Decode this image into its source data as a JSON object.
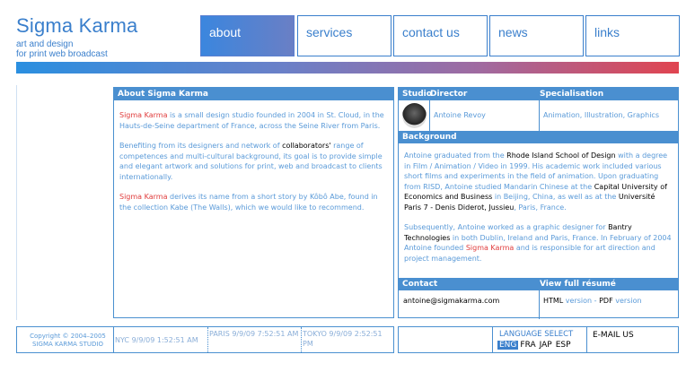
{
  "logo": {
    "title": "Sigma Karma",
    "subtitle_line1": "art and design",
    "subtitle_line2": "for print web broadcast"
  },
  "nav": [
    {
      "label": "about",
      "active": true
    },
    {
      "label": "services",
      "active": false
    },
    {
      "label": "contact us",
      "active": false
    },
    {
      "label": "news",
      "active": false
    },
    {
      "label": "links",
      "active": false
    }
  ],
  "about": {
    "header": "About Sigma Karma",
    "p1_brand": "Sigma Karma",
    "p1_rest": " is a small design studio founded in 2004 in St. Cloud, in the Hauts-de-Seine department of France, across the Seine River from Paris.",
    "p2_start": "Benefiting from its designers and network of ",
    "p2_link": "collaborators'",
    "p2_rest": " range of competences and multi-cultural background, its goal is to provide simple and elegant artwork and solutions for print, web and broadcast to clients internationally.",
    "p3_brand": "Sigma Karma",
    "p3_rest": " derives its name from a short story by Kôbô Abe, found in the collection Kabe (The Walls), which we would like to recommend."
  },
  "studio": {
    "header_studio": "Studio",
    "header_director": "Director",
    "header_specialisation": "Specialisation",
    "director_name": "Antoine Revoy",
    "specialisation": "Animation, Illustration, Graphics"
  },
  "background": {
    "header": "Background",
    "t1": "Antoine graduated from the ",
    "l1": "Rhode Island School of Design",
    "t2": " with a degree in Film / Animation / Video in 1999. His academic work included various short films and experiments in the field of animation. Upon graduating from RISD, Antoine studied Mandarin Chinese at the ",
    "l2": "Capital University of Economics and Business",
    "t3": " in Beijing, China, as well as at the ",
    "l3": "Université Paris 7 - Denis Diderot, Jussieu",
    "t4": ", Paris, France.",
    "t5": "Subsequently, Antoine worked as a graphic designer for ",
    "l4": "Bantry Technologies",
    "t6": " in both Dublin, Ireland and Paris, France. In February of 2004 Antoine founded ",
    "brand": "Sigma Karma",
    "t7": " and is responsible for art direction and project management."
  },
  "contact": {
    "header": "Contact",
    "email": "antoine@sigmakarma.com",
    "resume_header": "View full résumé",
    "html_label": "HTML",
    "version1": " version",
    "sep": " - ",
    "pdf_label": "PDF",
    "version2": " version"
  },
  "footer": {
    "copyright_line1": "Copyright © 2004–2005",
    "copyright_line2": "SIGMA KARMA STUDIO",
    "nyc": "NYC 9/9/09 1:52:51 AM",
    "paris": "PARIS 9/9/09 7:52:51 AM",
    "tokyo": "TOKYO 9/9/09 2:52:51 PM",
    "language_label": "LANGUAGE SELECT",
    "languages": [
      "ENG",
      "FRA",
      "JAP",
      "ESP"
    ],
    "email_us": "E-MAIL US"
  },
  "colors": {
    "accent": "#4a8fd0",
    "brand_red": "#e03c3c"
  }
}
